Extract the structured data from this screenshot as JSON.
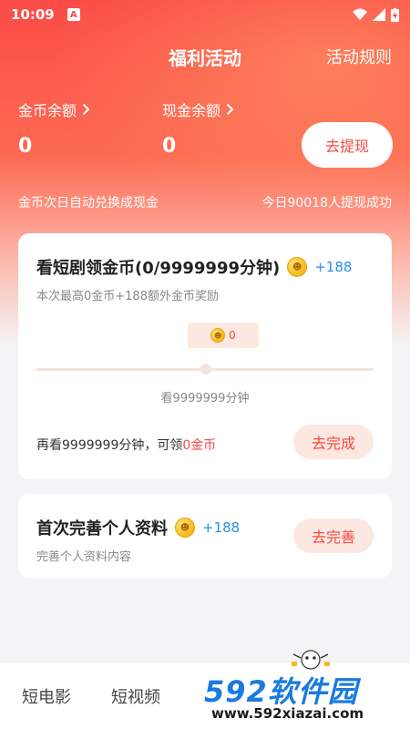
{
  "status_bar": {
    "time": "10:09",
    "badge": "A"
  },
  "header": {
    "title": "福利活动",
    "rules_link": "活动规则"
  },
  "balances": {
    "coin_label": "金币余额",
    "coin_value": "0",
    "cash_label": "现金余额",
    "cash_value": "0",
    "withdraw_button": "去提现",
    "auto_convert_note": "金币次日自动兑换成现金",
    "today_withdraw_note": "今日90018人提现成功"
  },
  "tasks": [
    {
      "title": "看短剧领金币(0/9999999分钟)",
      "reward": "+188",
      "subtitle": "本次最高0金币+188额外金币奖励",
      "progress_value": "0",
      "progress_caption": "看9999999分钟",
      "remain_prefix": "再看9999999分钟，可领",
      "remain_highlight": "0金币",
      "button": "去完成"
    },
    {
      "title": "首次完善个人资料",
      "reward": "+188",
      "subtitle": "完善个人资料内容",
      "button": "去完善"
    }
  ],
  "bottom_nav": {
    "items": [
      "短电影",
      "短视频"
    ]
  },
  "watermark": {
    "brand": "592软件园",
    "url": "www.592xiazai.com"
  },
  "colors": {
    "accent": "#f4493f",
    "reward_blue": "#2d8ee6"
  }
}
